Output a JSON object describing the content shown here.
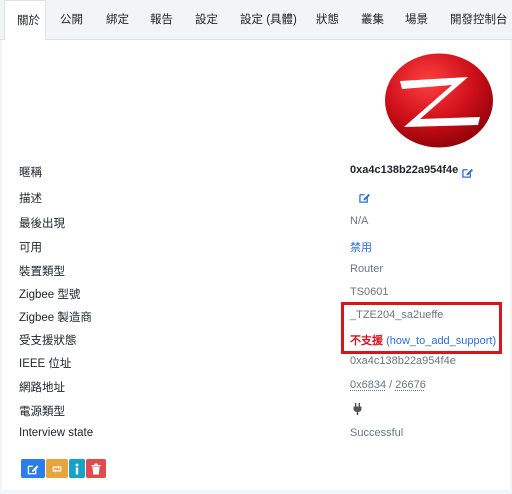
{
  "tabs": [
    {
      "label": "關於",
      "active": true
    },
    {
      "label": "公開",
      "active": false
    },
    {
      "label": "綁定",
      "active": false
    },
    {
      "label": "報告",
      "active": false
    },
    {
      "label": "設定",
      "active": false
    },
    {
      "label": "設定 (具體)",
      "active": false
    },
    {
      "label": "狀態",
      "active": false
    },
    {
      "label": "叢集",
      "active": false
    },
    {
      "label": "場景",
      "active": false
    },
    {
      "label": "開發控制台",
      "active": false
    }
  ],
  "details": {
    "friendly_name": {
      "label": "暱稱",
      "value": "0xa4c138b22a954f4e"
    },
    "description": {
      "label": "描述"
    },
    "last_seen": {
      "label": "最後出現",
      "value": "N/A"
    },
    "availability": {
      "label": "可用",
      "value": "禁用"
    },
    "device_type": {
      "label": "裝置類型",
      "value": "Router"
    },
    "zigbee_model": {
      "label": "Zigbee 型號",
      "value": "TS0601"
    },
    "zigbee_manufacturer": {
      "label": "Zigbee 製造商",
      "value": "_TZE204_sa2ueffe"
    },
    "support_status": {
      "label": "受支援狀態",
      "value": "不支援",
      "link": "how_to_add_support"
    },
    "ieee_address": {
      "label": "IEEE 位址",
      "value": "0xa4c138b22a954f4e"
    },
    "network_address": {
      "label": "網路地址",
      "hex": "0x6834",
      "separator": " / ",
      "dec": "26676"
    },
    "power_source": {
      "label": "電源類型",
      "icon": "plug-icon"
    },
    "interview_state": {
      "label": "Interview state",
      "value": "Successful"
    }
  },
  "logo": {
    "icon": "zigbee-logo"
  },
  "colors": {
    "accent_blue": "#2d6cdf",
    "unsupported_red": "#d9141b",
    "btn_blue": "#2b7de9",
    "btn_orange": "#e8a33d",
    "btn_info": "#17a2c8",
    "btn_red": "#de4c4c"
  },
  "actions": [
    {
      "name": "edit-button",
      "icon": "edit-icon"
    },
    {
      "name": "reconfigure-button",
      "icon": "reconfigure-icon"
    },
    {
      "name": "interview-button",
      "icon": "info-icon"
    },
    {
      "name": "remove-button",
      "icon": "trash-icon"
    }
  ]
}
